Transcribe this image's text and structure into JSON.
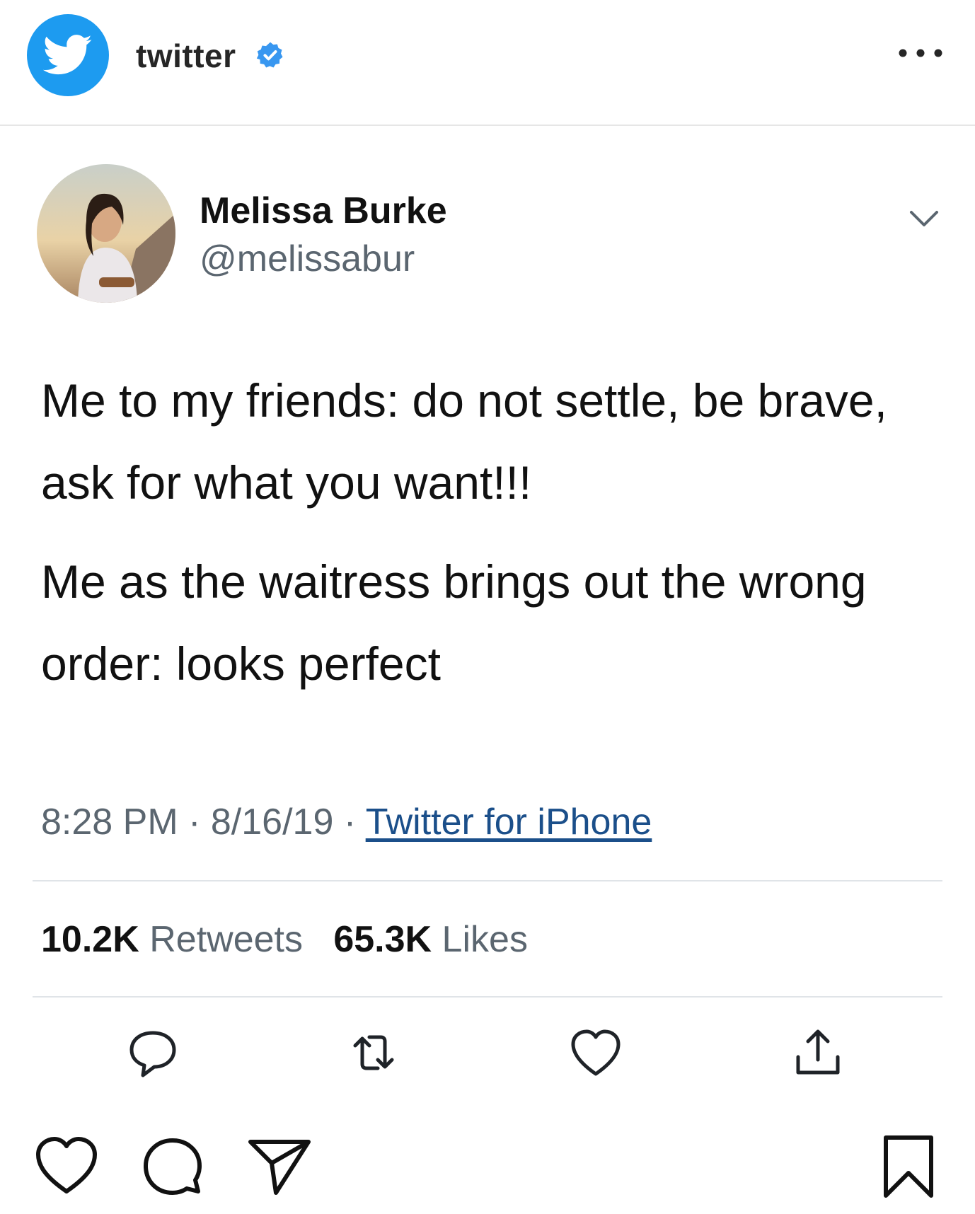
{
  "header": {
    "account_name": "twitter",
    "icons": [
      "twitter-bird-icon",
      "verified-badge-icon",
      "more-options-icon"
    ]
  },
  "tweet": {
    "display_name": "Melissa Burke",
    "handle": "@melissabur",
    "paragraphs": [
      "Me to my friends: do not settle, be brave, ask for what you want!!!",
      "Me as the waitress brings out the wrong order: looks perfect"
    ],
    "time": "8:28 PM",
    "date": "8/16/19",
    "separator": "·",
    "source": "Twitter for iPhone",
    "retweets_count": "10.2K",
    "retweets_label": "Retweets",
    "likes_count": "65.3K",
    "likes_label": "Likes"
  },
  "tweet_actions": [
    "reply-icon",
    "retweet-icon",
    "like-icon",
    "share-icon"
  ],
  "post_actions": [
    "heart-icon",
    "comment-icon",
    "send-icon",
    "bookmark-icon"
  ],
  "colors": {
    "twitter_blue": "#1d9bf0",
    "text": "#111111",
    "secondary": "#5b6670",
    "link": "#1b4f8a",
    "divider": "#e0e4e8"
  }
}
